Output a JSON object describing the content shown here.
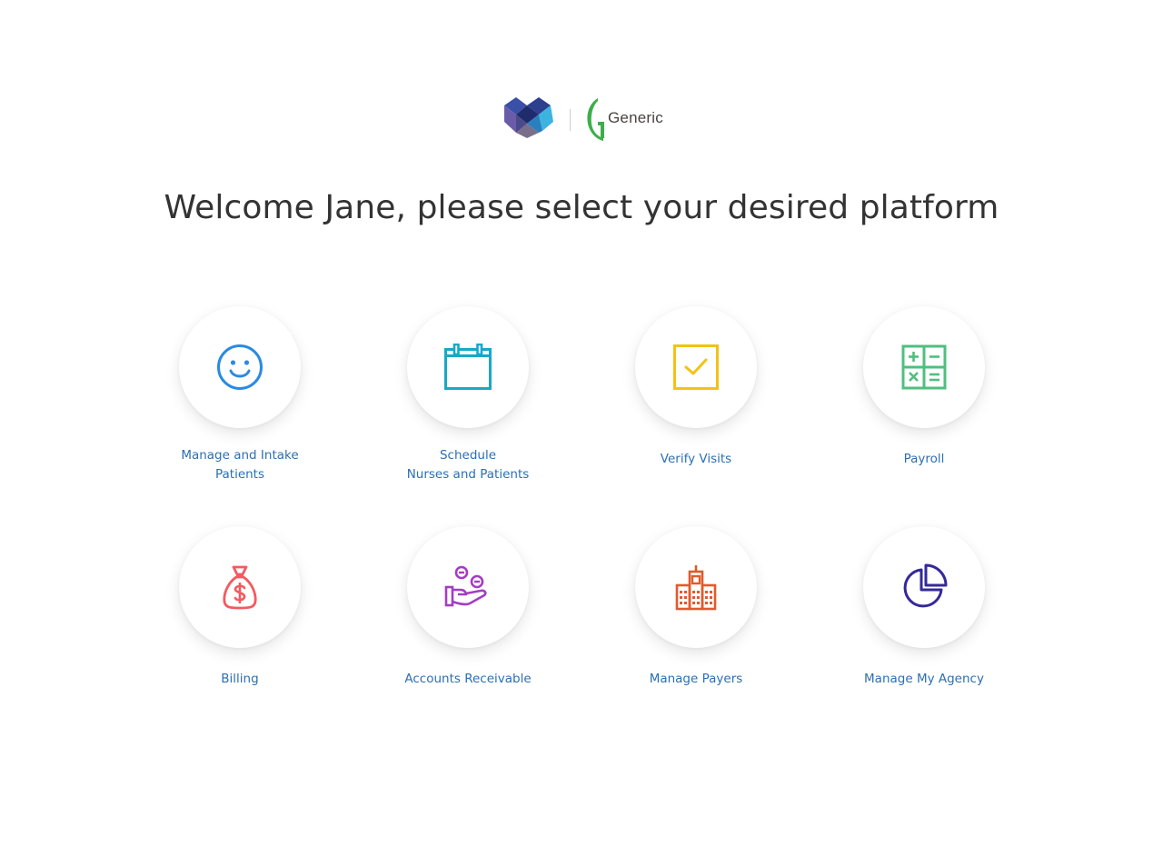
{
  "branding": {
    "partner_name": "Generic"
  },
  "welcome": {
    "heading": "Welcome Jane, please select your desired platform"
  },
  "platforms": [
    {
      "label_line1": "Manage and Intake",
      "label_line2": "Patients",
      "icon": "smiley-face-icon",
      "color": "#2a8be0"
    },
    {
      "label_line1": "Schedule",
      "label_line2": "Nurses and Patients",
      "icon": "calendar-icon",
      "color": "#17a9c6"
    },
    {
      "label_line1": "Verify Visits",
      "label_line2": "",
      "icon": "checkbox-icon",
      "color": "#f4c215"
    },
    {
      "label_line1": "Payroll",
      "label_line2": "",
      "icon": "calculator-icon",
      "color": "#4fbf7f"
    },
    {
      "label_line1": "Billing",
      "label_line2": "",
      "icon": "money-bag-icon",
      "color": "#f35a5f"
    },
    {
      "label_line1": "Accounts Receivable",
      "label_line2": "",
      "icon": "hand-coins-icon",
      "color": "#a43cc4"
    },
    {
      "label_line1": "Manage Payers",
      "label_line2": "",
      "icon": "buildings-icon",
      "color": "#e25a2a"
    },
    {
      "label_line1": "Manage My Agency",
      "label_line2": "",
      "icon": "pie-chart-icon",
      "color": "#35299a"
    }
  ]
}
